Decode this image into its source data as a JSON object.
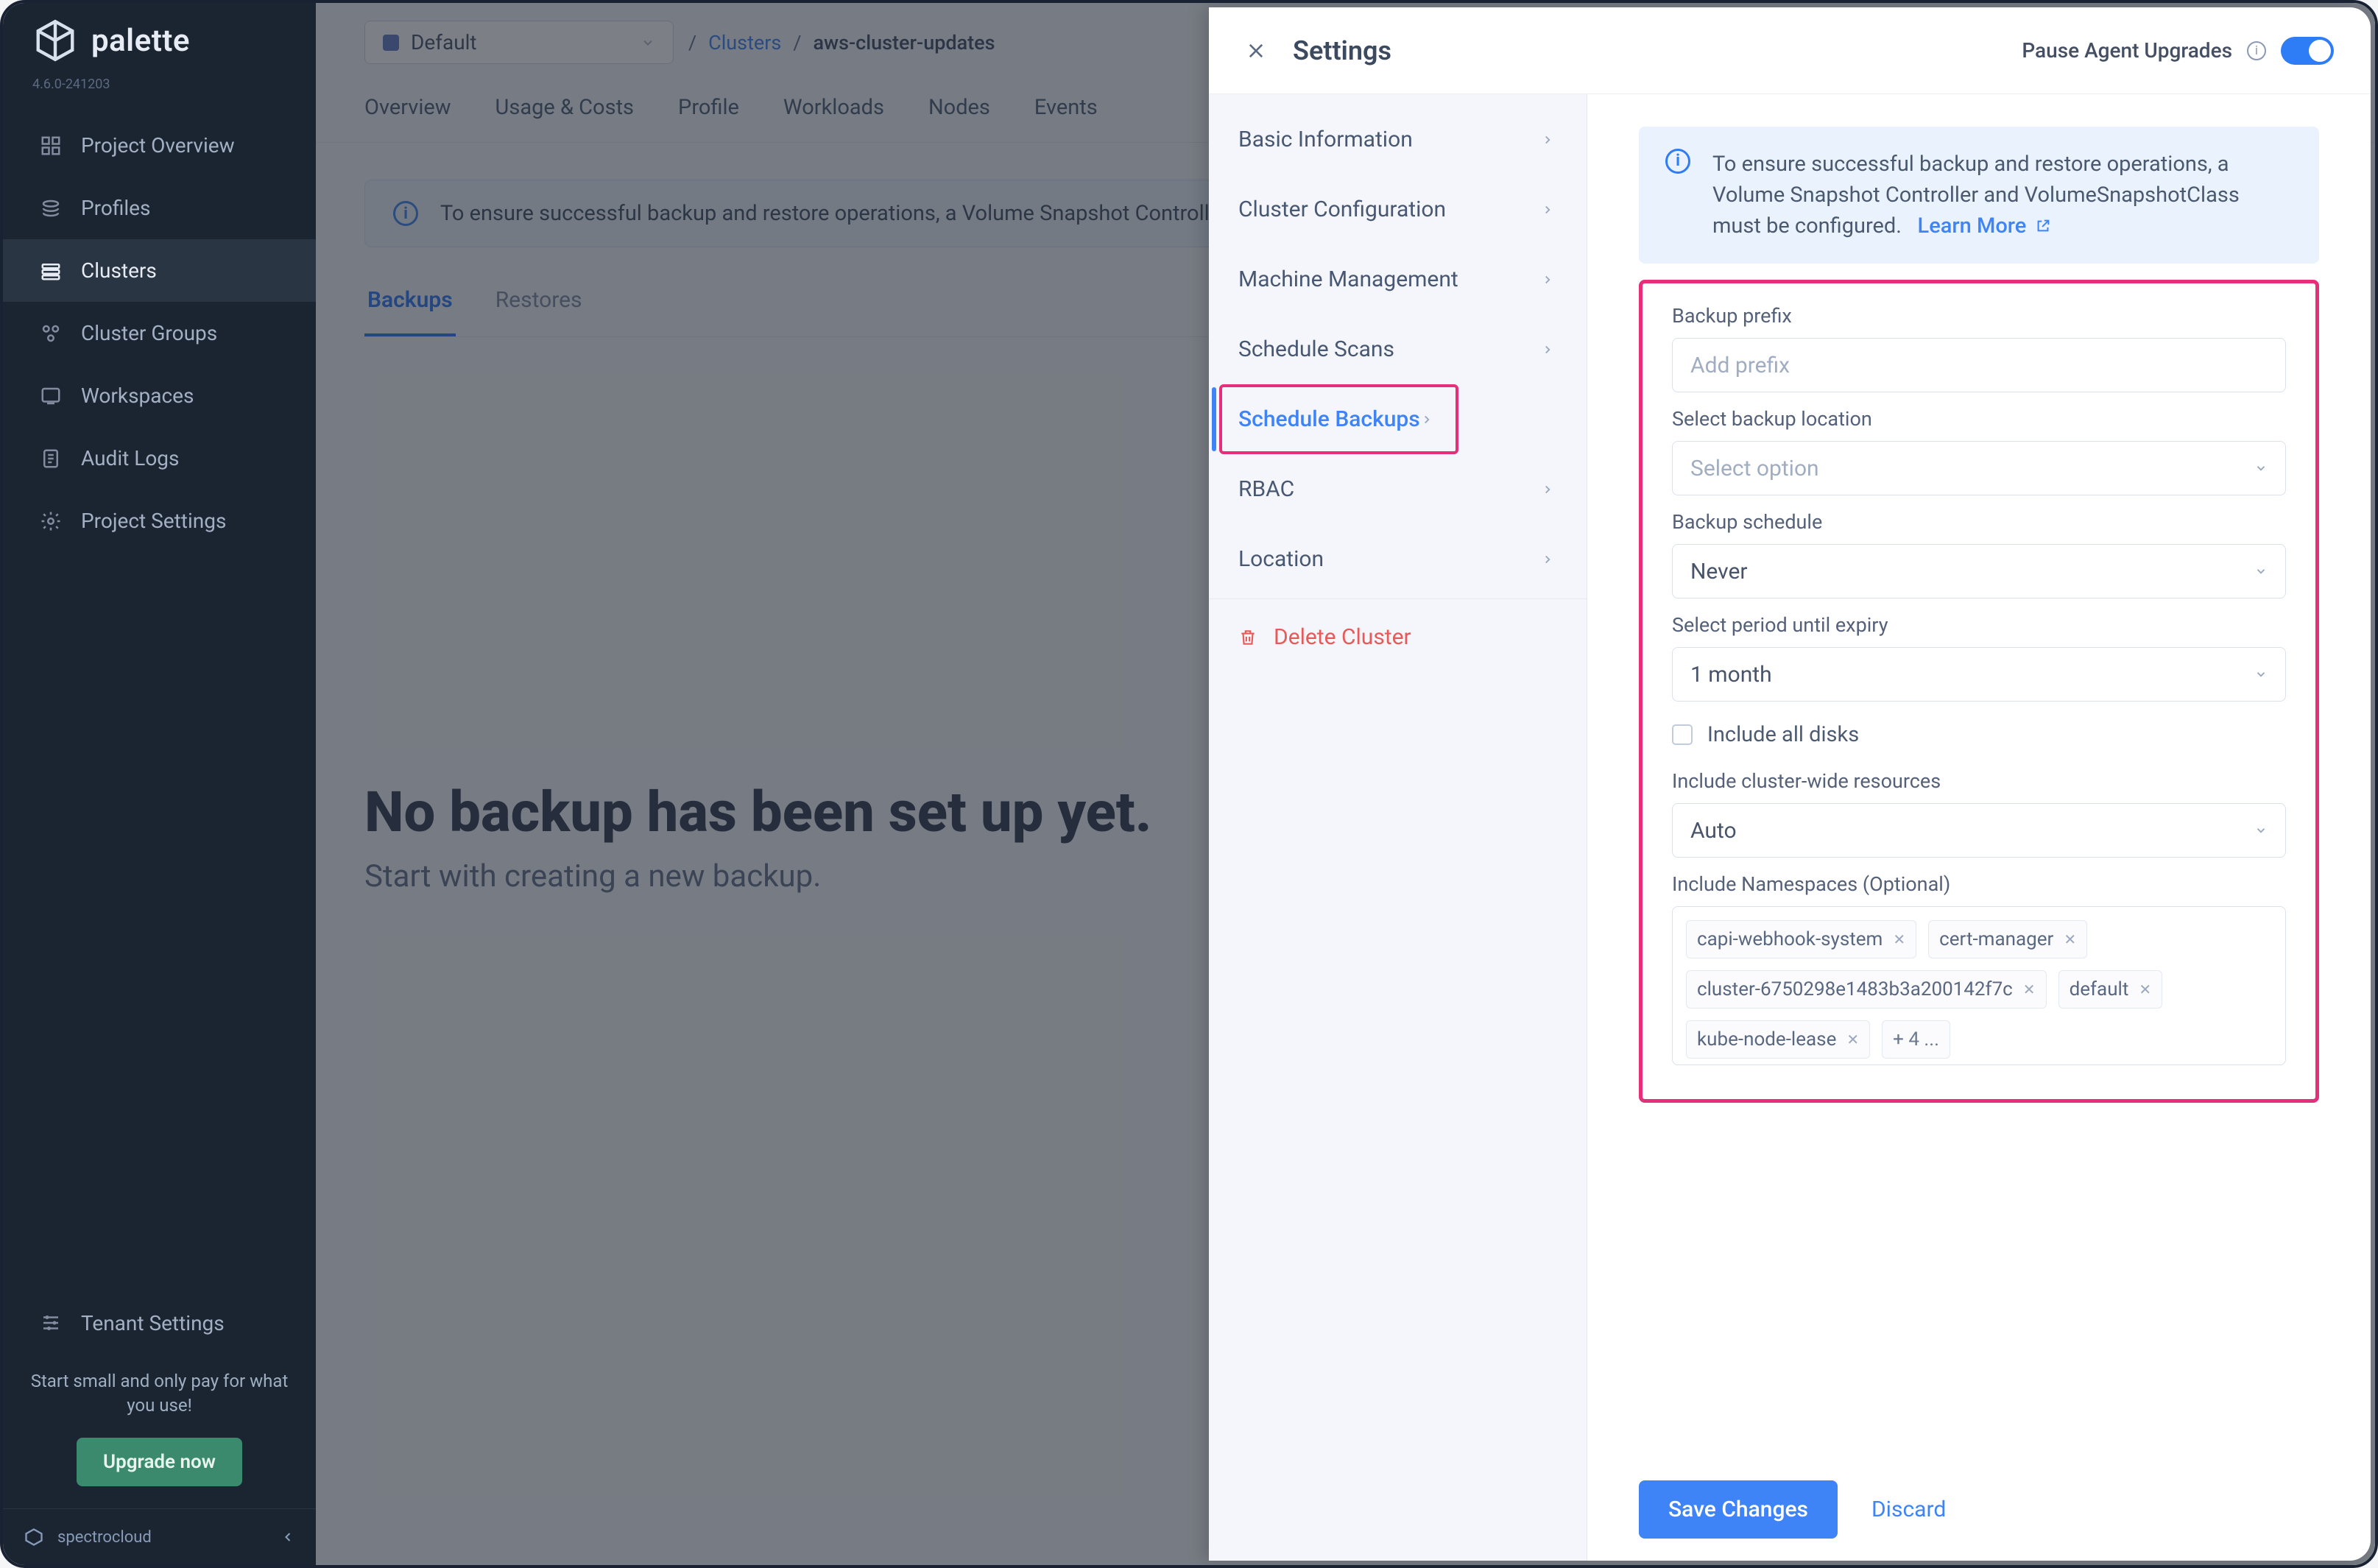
{
  "brand": {
    "name": "palette",
    "version": "4.6.0-241203",
    "tenant": "spectrocloud"
  },
  "sidebar": {
    "items": [
      {
        "label": "Project Overview"
      },
      {
        "label": "Profiles"
      },
      {
        "label": "Clusters"
      },
      {
        "label": "Cluster Groups"
      },
      {
        "label": "Workspaces"
      },
      {
        "label": "Audit Logs"
      },
      {
        "label": "Project Settings"
      }
    ],
    "tenant_settings": "Tenant Settings",
    "promo": "Start small and only pay for what you use!",
    "upgrade": "Upgrade now"
  },
  "scope": {
    "label": "Default"
  },
  "breadcrumbs": {
    "parent": "Clusters",
    "current": "aws-cluster-updates"
  },
  "tabs": [
    "Overview",
    "Usage & Costs",
    "Profile",
    "Workloads",
    "Nodes",
    "Events"
  ],
  "info_banner": "To ensure successful backup and restore operations, a Volume Snapshot Controller and VolumeSnapshotClass must be configured.",
  "subtabs": {
    "backups": "Backups",
    "restores": "Restores"
  },
  "empty": {
    "title": "No backup has been set up yet.",
    "sub": "Start with creating a new backup."
  },
  "drawer": {
    "title": "Settings",
    "pause_label": "Pause Agent Upgrades",
    "nav": [
      "Basic Information",
      "Cluster Configuration",
      "Machine Management",
      "Schedule Scans",
      "Schedule Backups",
      "RBAC",
      "Location"
    ],
    "delete": "Delete Cluster",
    "banner": {
      "text": "To ensure successful backup and restore operations, a Volume Snapshot Controller and VolumeSnapshotClass must be configured.",
      "learn_more": "Learn More"
    },
    "form": {
      "prefix_label": "Backup prefix",
      "prefix_placeholder": "Add prefix",
      "location_label": "Select backup location",
      "location_placeholder": "Select option",
      "schedule_label": "Backup schedule",
      "schedule_value": "Never",
      "expiry_label": "Select period until expiry",
      "expiry_value": "1 month",
      "include_disks_label": "Include all disks",
      "cluster_wide_label": "Include cluster-wide resources",
      "cluster_wide_value": "Auto",
      "namespaces_label": "Include Namespaces (Optional)",
      "namespaces": [
        "capi-webhook-system",
        "cert-manager",
        "cluster-6750298e1483b3a200142f7c",
        "default",
        "kube-node-lease"
      ],
      "namespaces_more": "+ 4 ..."
    },
    "footer": {
      "save": "Save Changes",
      "discard": "Discard"
    }
  }
}
